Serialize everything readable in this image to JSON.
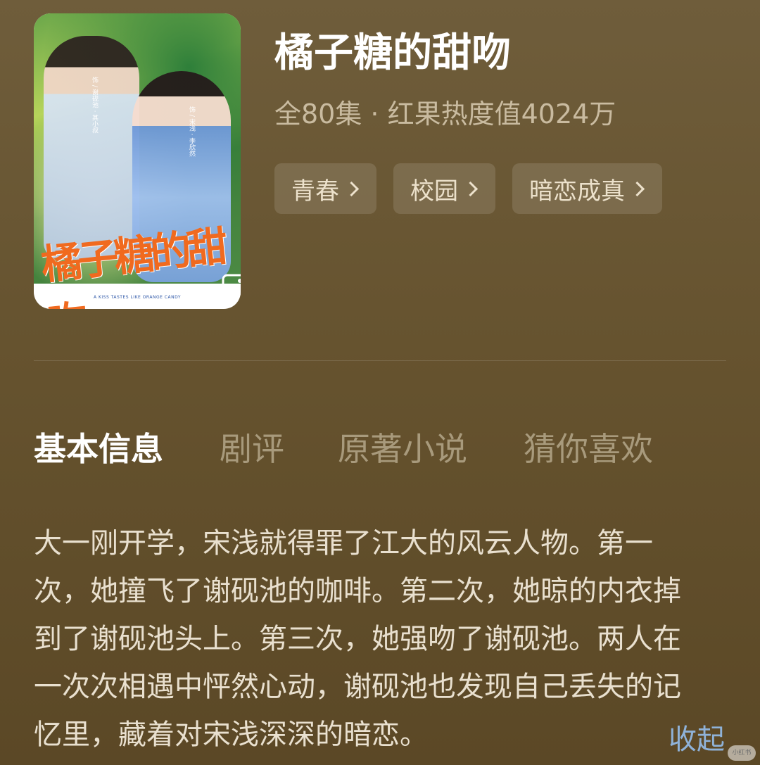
{
  "drama": {
    "title": "橘子糖的甜吻",
    "meta": "全80集 · 红果热度值4024万",
    "tags": [
      {
        "label": "青春"
      },
      {
        "label": "校园"
      },
      {
        "label": "暗恋成真"
      }
    ]
  },
  "poster": {
    "cast_left": "饰 / 谢砚池 · 其小叔",
    "cast_right": "饰 / 宋浅 · 李欣然",
    "logo_text": "橘子糖的甜吻",
    "caption": "A KISS TASTES LIKE ORANGE CANDY",
    "icon": "image-icon"
  },
  "tabs": [
    {
      "label": "基本信息",
      "active": true
    },
    {
      "label": "剧评",
      "active": false
    },
    {
      "label": "原著小说",
      "active": false
    },
    {
      "label": "猜你喜欢",
      "active": false
    }
  ],
  "synopsis": {
    "lines": [
      "大一刚开学，宋浅就得罪了江大的风云人物。第一",
      "次，她撞飞了谢砚池的咖啡。第二次，她晾的内衣掉",
      "到了谢砚池头上。第三次，她强吻了谢砚池。两人在",
      "一次次相遇中怦然心动，谢砚池也发现自己丢失的记",
      "忆里，藏着对宋浅深深的暗恋。"
    ],
    "collapse_label": "收起"
  },
  "watermark": "小红书",
  "colors": {
    "background": "#66532f",
    "accent_link": "#8fb2d8",
    "logo_orange": "#f06a1f"
  }
}
